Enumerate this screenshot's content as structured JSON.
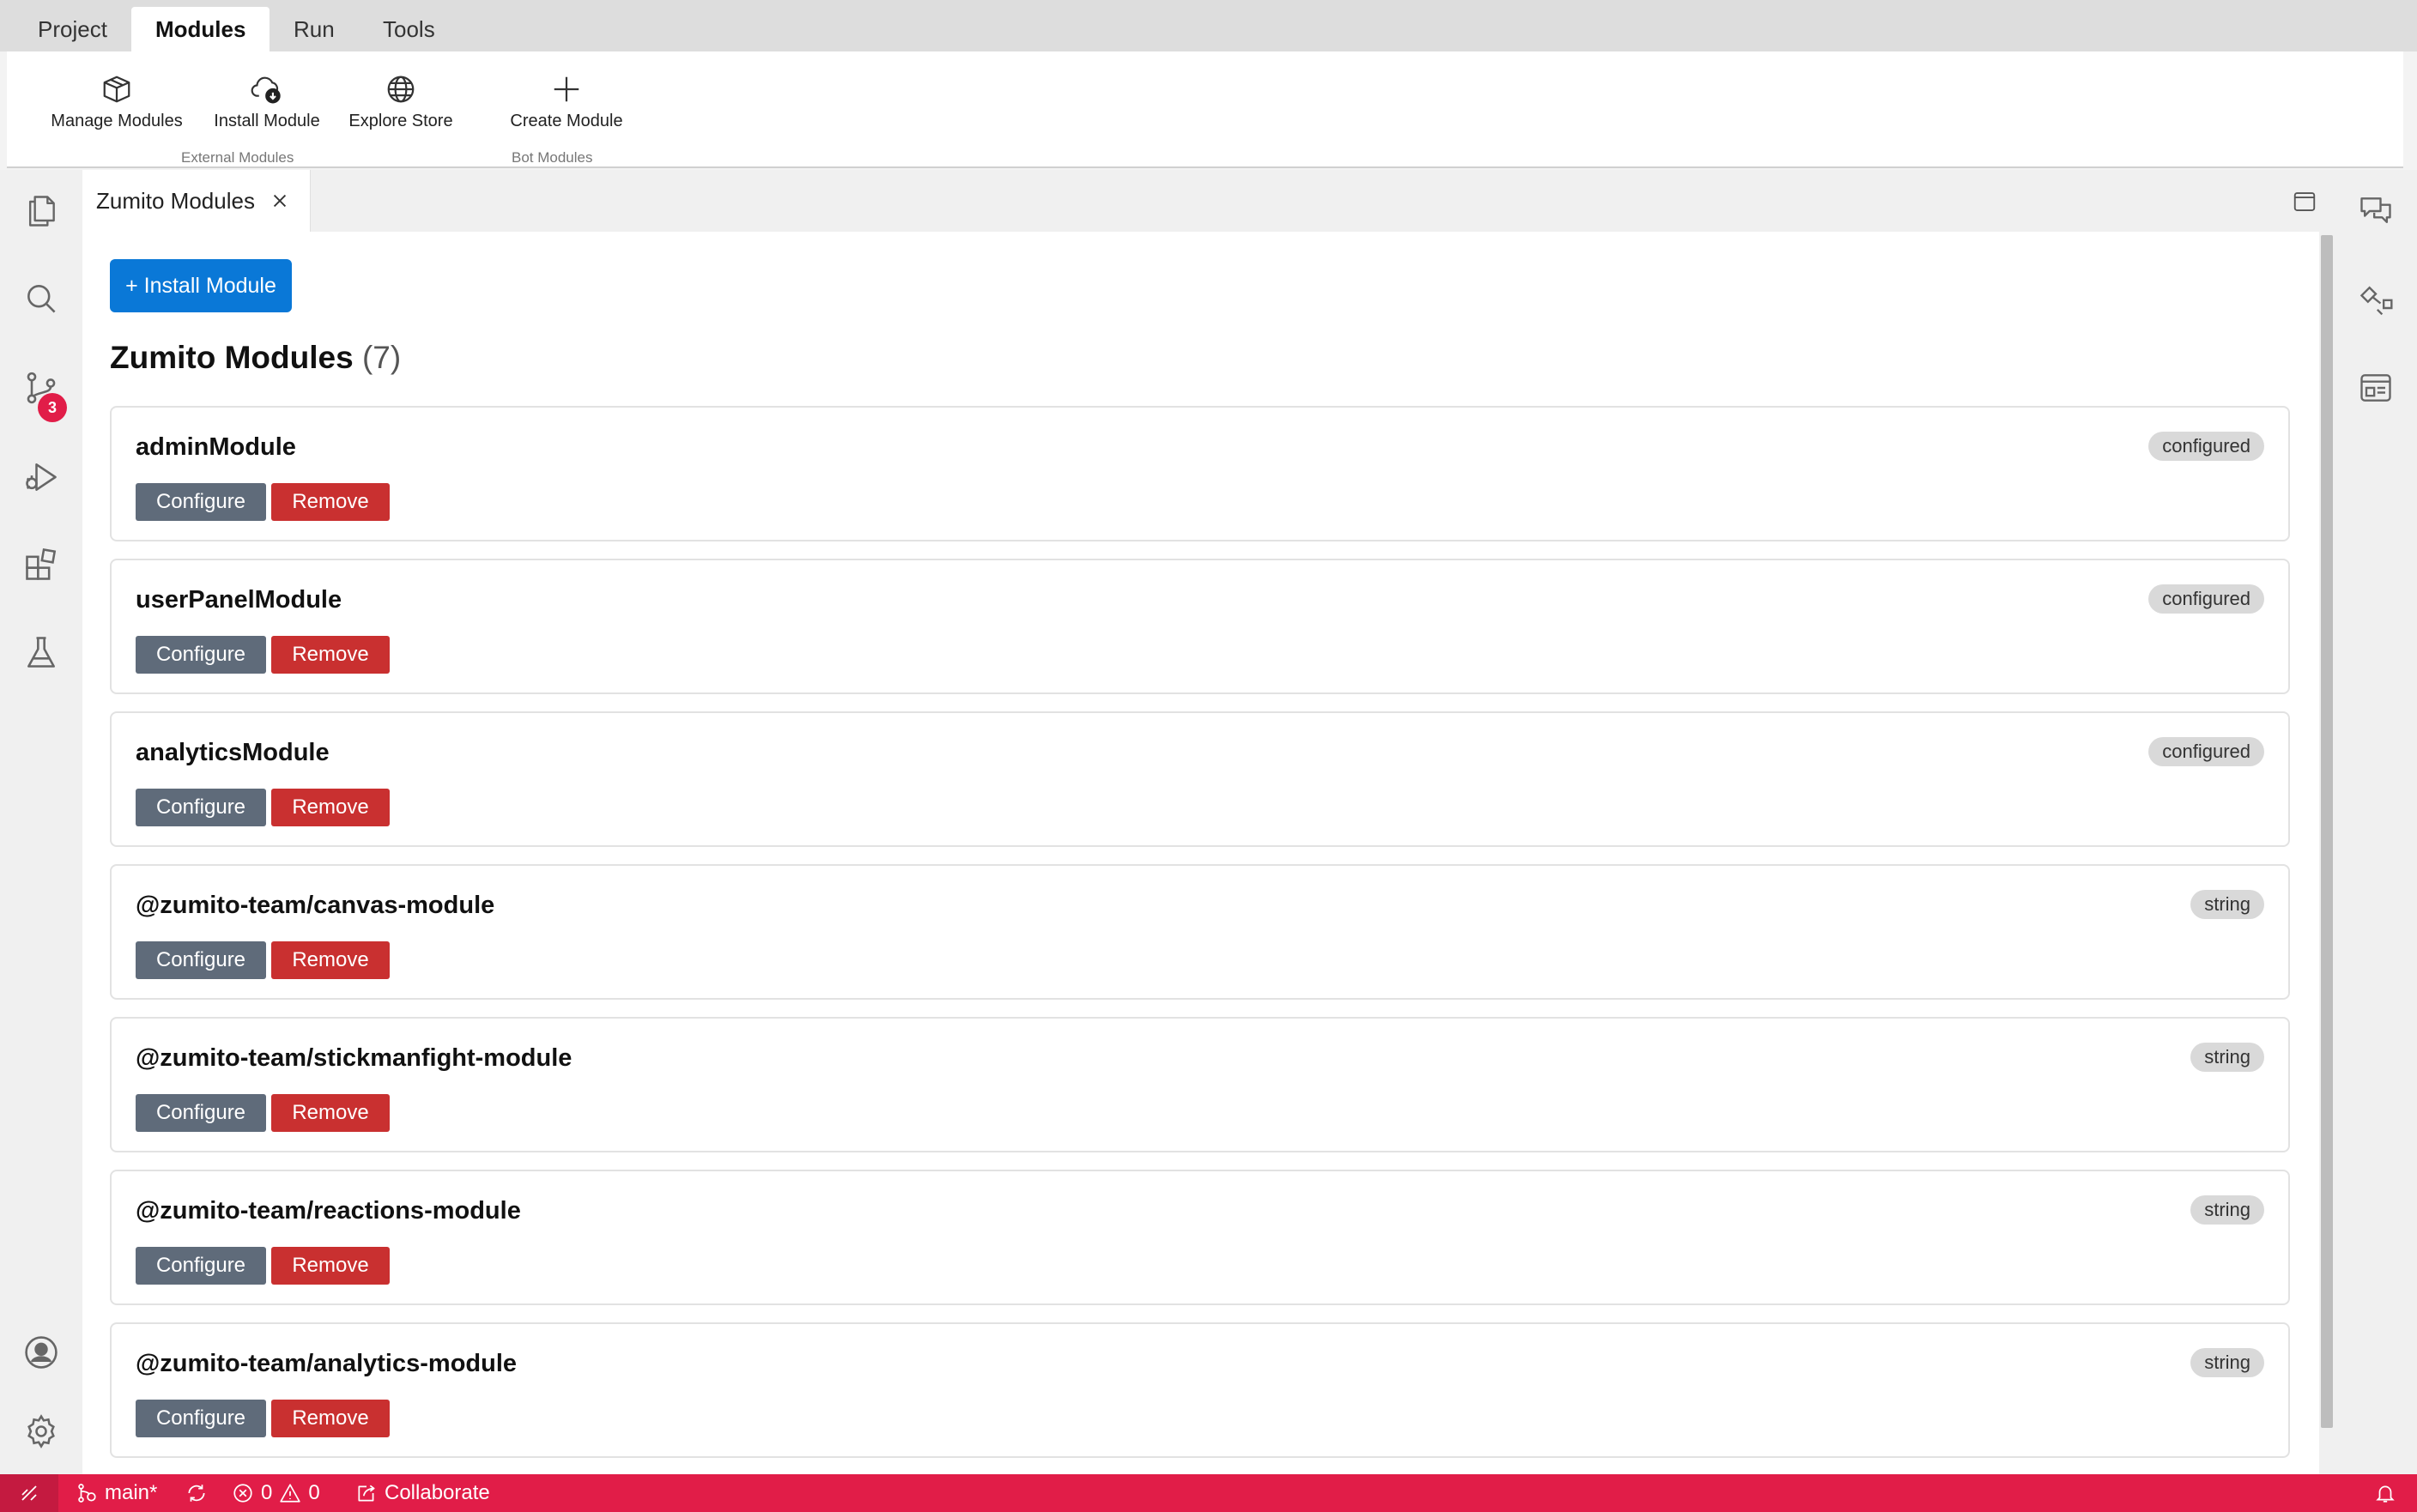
{
  "menu": {
    "tabs": [
      {
        "label": "Project"
      },
      {
        "label": "Modules"
      },
      {
        "label": "Run"
      },
      {
        "label": "Tools"
      }
    ],
    "active": "Modules"
  },
  "ribbon": {
    "manage": "Manage Modules",
    "install": "Install Module",
    "explore": "Explore Store",
    "create": "Create Module",
    "group_external": "External Modules",
    "group_bot": "Bot Modules"
  },
  "activity_bar": {
    "source_control_badge": "3",
    "left_icons": [
      "files-icon",
      "search-icon",
      "source-control-icon",
      "run-debug-icon",
      "extensions-icon",
      "testing-icon",
      "account-icon",
      "settings-icon"
    ],
    "right_icons": [
      "chat-icon",
      "flow-icon",
      "panel-icon"
    ]
  },
  "editor_tab": {
    "title": "Zumito Modules"
  },
  "page": {
    "install_button": "+ Install Module",
    "heading": "Zumito Modules",
    "count": "(7)",
    "configure_label": "Configure",
    "remove_label": "Remove"
  },
  "modules": [
    {
      "name": "adminModule",
      "status": "configured"
    },
    {
      "name": "userPanelModule",
      "status": "configured"
    },
    {
      "name": "analyticsModule",
      "status": "configured"
    },
    {
      "name": "@zumito-team/canvas-module",
      "status": "string"
    },
    {
      "name": "@zumito-team/stickmanfight-module",
      "status": "string"
    },
    {
      "name": "@zumito-team/reactions-module",
      "status": "string"
    },
    {
      "name": "@zumito-team/analytics-module",
      "status": "string"
    }
  ],
  "statusbar": {
    "branch": "main*",
    "errors": "0",
    "warnings": "0",
    "collaborate": "Collaborate"
  },
  "colors": {
    "accent": "#0a78d7",
    "status_bar": "#e11d48",
    "remove": "#c93030",
    "configure": "#5f6b7a"
  }
}
